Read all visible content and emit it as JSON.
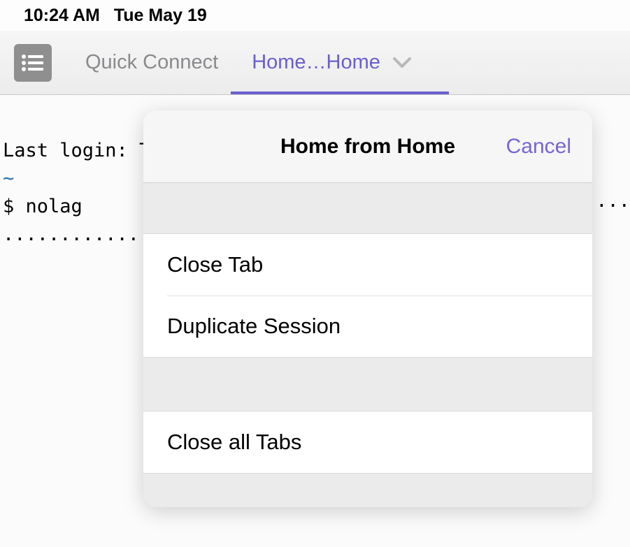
{
  "status_bar": {
    "time": "10:24 AM",
    "date": "Tue May 19"
  },
  "tab_bar": {
    "quick_connect": "Quick Connect",
    "active_tab": "Home…Home"
  },
  "terminal": {
    "line1": "Last login: T",
    "tilde": "~",
    "line3": "$ nolag",
    "dots_left": "....................",
    "dots_right": "...."
  },
  "popover": {
    "title": "Home from Home",
    "cancel": "Cancel",
    "items_group1": [
      "Close Tab",
      "Duplicate Session"
    ],
    "items_group2": [
      "Close all Tabs"
    ]
  },
  "colors": {
    "accent": "#6a5fcf",
    "link": "#7766d3"
  }
}
